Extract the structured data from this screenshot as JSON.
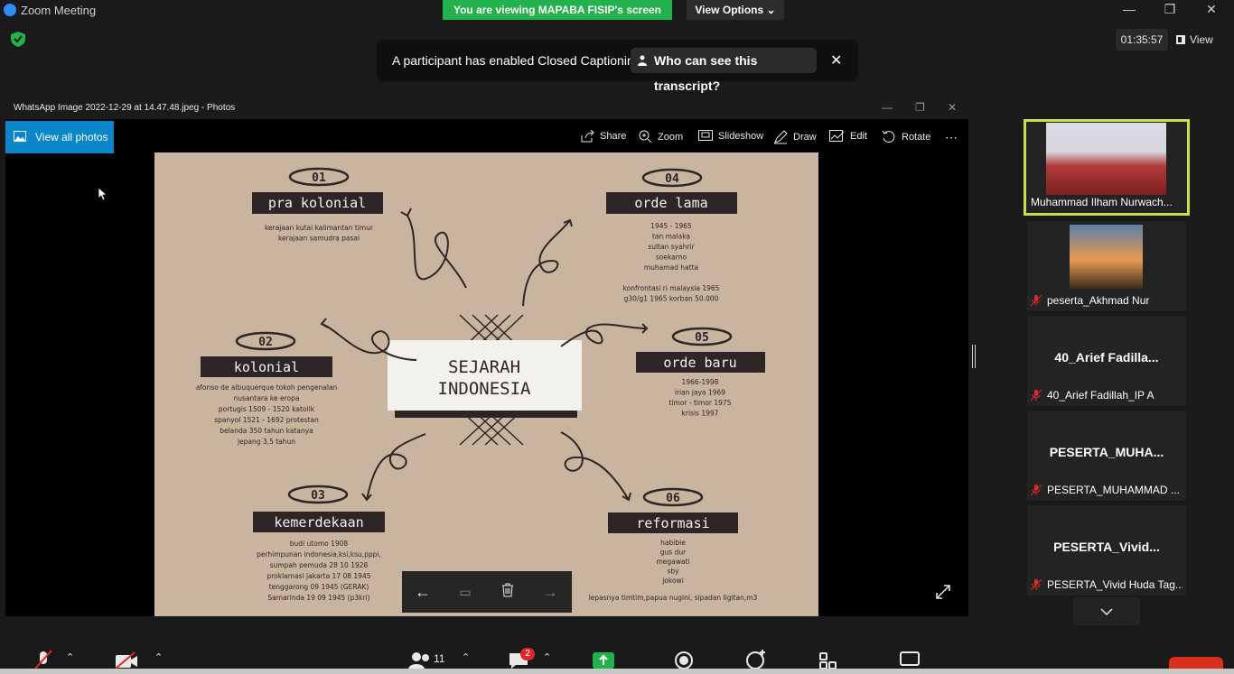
{
  "zoom": {
    "title": "Zoom Meeting",
    "share_banner": "You are viewing MAPABA FISIP's screen",
    "view_options": "View Options",
    "timer": "01:35:57",
    "view_label": "View"
  },
  "captions": {
    "message": "A participant has enabled Closed Captioning",
    "button": "Who can see this transcript?"
  },
  "photos": {
    "window_title": "WhatsApp Image 2022-12-29 at 14.47.48.jpeg - Photos",
    "view_all": "View all photos",
    "toolbar": {
      "share": "Share",
      "zoom": "Zoom",
      "slideshow": "Slideshow",
      "draw": "Draw",
      "edit": "Edit",
      "rotate": "Rotate"
    }
  },
  "slide": {
    "title_line1": "SEJARAH",
    "title_line2": "INDONESIA",
    "sections": [
      {
        "num": "01",
        "title": "pra kolonial",
        "lines": [
          "kerajaan kutai kalimantan timur",
          "kerajaan samudra pasai"
        ]
      },
      {
        "num": "02",
        "title": "kolonial",
        "lines": [
          "afonso de albuquerque tokoh pengenalan",
          "nusantara ke eropa",
          "portugis 1509 - 1520 katolik",
          "spanyol 1521 - 1692 protestan",
          "belanda 350 tahun katanya",
          "jepang 3,5 tahun"
        ]
      },
      {
        "num": "03",
        "title": "kemerdekaan",
        "lines": [
          "budi utomo 1908",
          "perhimpunan indonesia,ksi,ksu,pppi,",
          "sumpah pemuda 28 10 1928",
          "proklamasi jakarta 17 08 1945",
          "tenggarong 09 1945 (GERAK)",
          "Samarinda 19 09 1945 (p3kri)"
        ]
      },
      {
        "num": "04",
        "title": "orde lama",
        "lines": [
          "1945 - 1965",
          "tan malaka",
          "sultan syahrir",
          "soekarno",
          "muhamad hatta",
          "",
          "konfrontasi ri malaysia 1965",
          "g30/g1 1965 korban 50.000"
        ]
      },
      {
        "num": "05",
        "title": "orde baru",
        "lines": [
          "1966-1998",
          "irian jaya 1969",
          "timor - timor 1975",
          "krisis 1997"
        ]
      },
      {
        "num": "06",
        "title": "reformasi",
        "lines": [
          "habibie",
          "gus dur",
          "megawati",
          "sby",
          "jokowi",
          "",
          "lepasnya timtim,papua nugini, sipadan ligitan,m3"
        ]
      }
    ]
  },
  "participants": [
    {
      "name": "Muhammad Ilham Nurwach...",
      "big": "",
      "video": true
    },
    {
      "name": "peserta_Akhmad Nur",
      "big": "",
      "video": false
    },
    {
      "name": "40_Arief Fadillah_IP A",
      "big": "40_Arief  Fadilla..."
    },
    {
      "name": "PESERTA_MUHAMMAD ...",
      "big": "PESERTA_MUHA..."
    },
    {
      "name": "PESERTA_Vivid Huda Tag...",
      "big": "PESERTA_Vivid..."
    }
  ],
  "toolbar_bottom": {
    "participants_count": "11",
    "chat_badge": "2"
  },
  "colors": {
    "share_green": "#23b14d",
    "active_speaker": "#c6e24a",
    "photos_blue": "#0a86c9",
    "end_red": "#d9301e"
  }
}
